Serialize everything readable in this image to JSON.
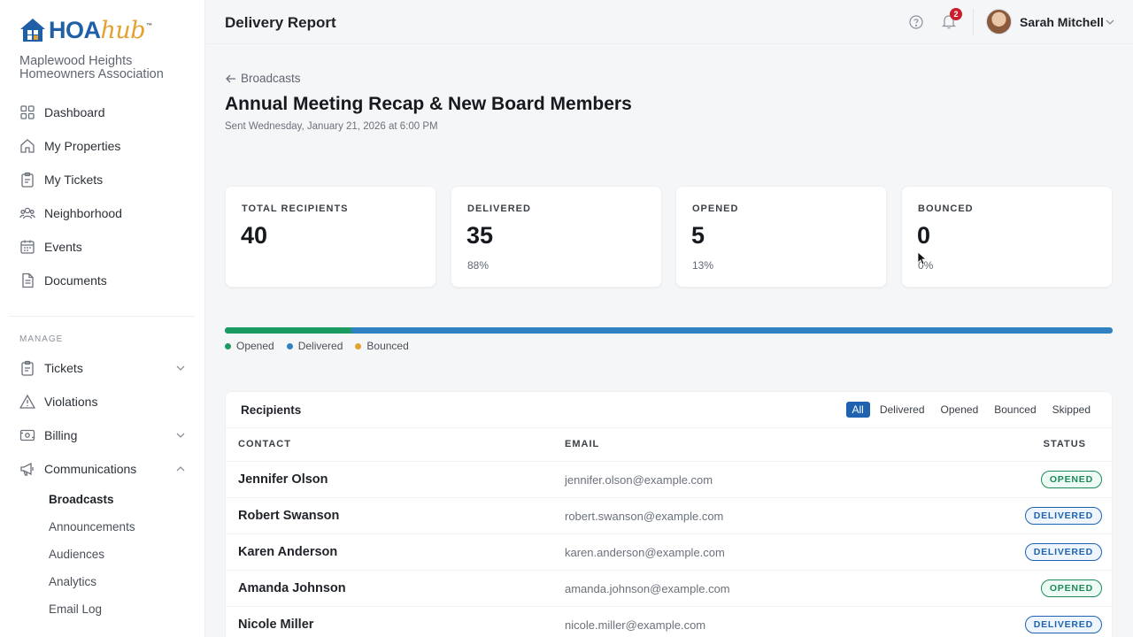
{
  "brand": {
    "logo_primary": "HOA",
    "logo_secondary": "hub",
    "logo_tm": "™",
    "org_name": "Maplewood Heights Homeowners Association",
    "colors": {
      "primary": "#1f5fa8",
      "accent": "#e3a230"
    }
  },
  "sidebar": {
    "items": [
      {
        "label": "Dashboard",
        "icon": "dashboard-icon"
      },
      {
        "label": "My Properties",
        "icon": "home-icon"
      },
      {
        "label": "My Tickets",
        "icon": "clipboard-icon"
      },
      {
        "label": "Neighborhood",
        "icon": "people-icon"
      },
      {
        "label": "Events",
        "icon": "calendar-icon"
      },
      {
        "label": "Documents",
        "icon": "document-icon"
      }
    ],
    "manage_label": "MANAGE",
    "manage_items": [
      {
        "label": "Tickets",
        "icon": "clipboard-icon",
        "expandable": "collapsed"
      },
      {
        "label": "Violations",
        "icon": "warning-icon"
      },
      {
        "label": "Billing",
        "icon": "billing-icon",
        "expandable": "collapsed"
      },
      {
        "label": "Communications",
        "icon": "megaphone-icon",
        "expandable": "expanded"
      }
    ],
    "sub_items": [
      {
        "label": "Broadcasts",
        "active": true
      },
      {
        "label": "Announcements"
      },
      {
        "label": "Audiences"
      },
      {
        "label": "Analytics"
      },
      {
        "label": "Email Log"
      }
    ]
  },
  "header": {
    "title": "Delivery Report",
    "notification_count": "2",
    "user_name": "Sarah Mitchell"
  },
  "broadcast": {
    "back_label": "Broadcasts",
    "title": "Annual Meeting Recap & New Board Members",
    "sent": "Sent Wednesday, January 21, 2026 at 6:00 PM"
  },
  "stats": [
    {
      "label": "TOTAL RECIPIENTS",
      "value": "40",
      "pct": ""
    },
    {
      "label": "DELIVERED",
      "value": "35",
      "pct": "88%"
    },
    {
      "label": "OPENED",
      "value": "5",
      "pct": "13%"
    },
    {
      "label": "BOUNCED",
      "value": "0",
      "pct": "0%"
    }
  ],
  "progress": {
    "opened_fraction": 0.143,
    "delivered_fraction": 0.857,
    "bounced_fraction": 0,
    "colors": {
      "opened": "#1b9a62",
      "delivered": "#2f82c1",
      "bounced": "#e3a230"
    }
  },
  "legend": [
    "Opened",
    "Delivered",
    "Bounced"
  ],
  "recipients": {
    "title": "Recipients",
    "filters": [
      "All",
      "Delivered",
      "Opened",
      "Bounced",
      "Skipped"
    ],
    "active_filter": "All",
    "columns": [
      "CONTACT",
      "EMAIL",
      "STATUS"
    ],
    "rows": [
      {
        "name": "Jennifer Olson",
        "email": "jennifer.olson@example.com",
        "status": "OPENED"
      },
      {
        "name": "Robert Swanson",
        "email": "robert.swanson@example.com",
        "status": "DELIVERED"
      },
      {
        "name": "Karen Anderson",
        "email": "karen.anderson@example.com",
        "status": "DELIVERED"
      },
      {
        "name": "Amanda Johnson",
        "email": "amanda.johnson@example.com",
        "status": "OPENED"
      },
      {
        "name": "Nicole Miller",
        "email": "nicole.miller@example.com",
        "status": "DELIVERED"
      }
    ]
  }
}
